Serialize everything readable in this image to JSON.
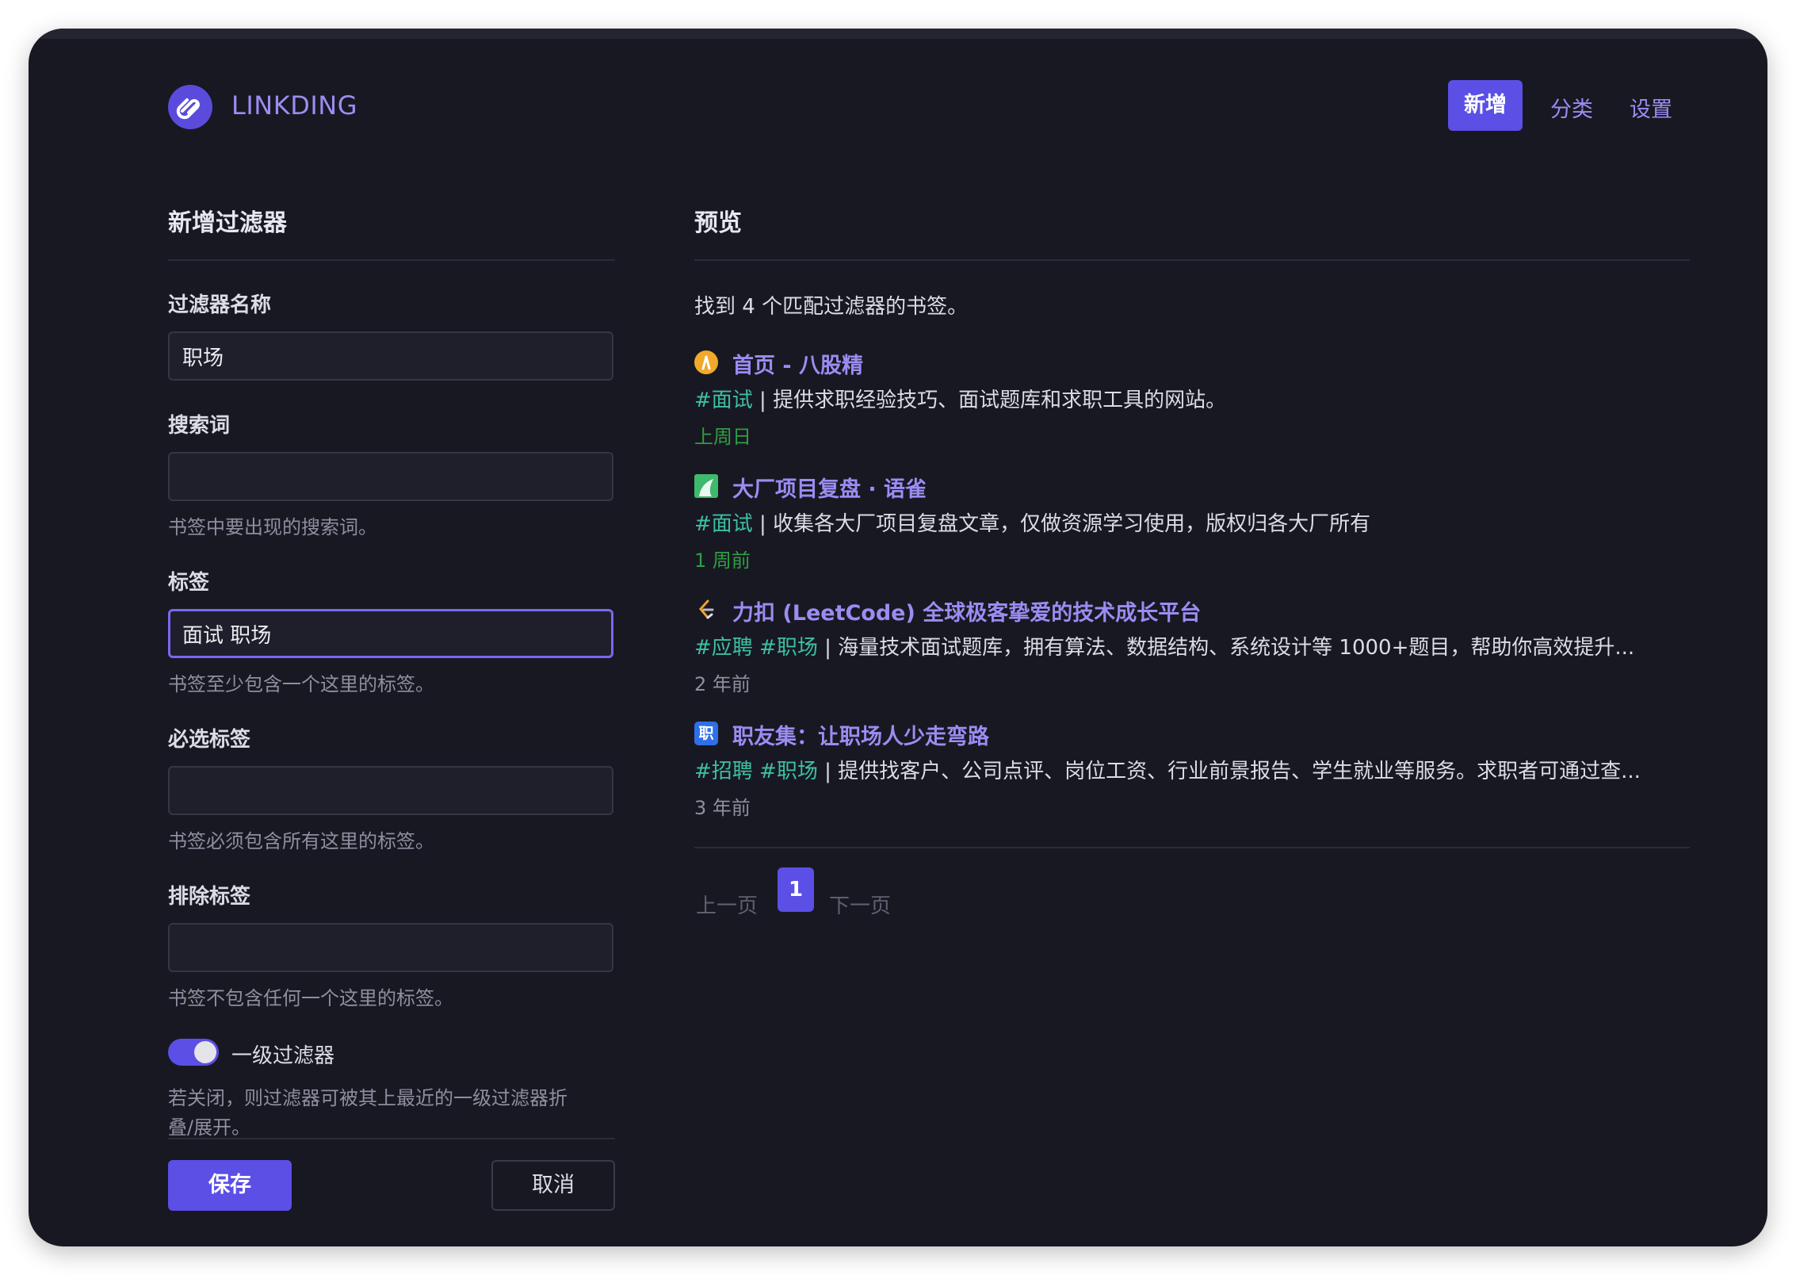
{
  "header": {
    "brand": "LINKDING",
    "nav_add": "新增",
    "nav_tags": "分类",
    "nav_settings": "设置"
  },
  "form": {
    "title": "新增过滤器",
    "name_label": "过滤器名称",
    "name_value": "职场",
    "search_label": "搜索词",
    "search_value": "",
    "search_hint": "书签中要出现的搜索词。",
    "tags_label": "标签",
    "tags_value": "面试 职场",
    "tags_hint": "书签至少包含一个这里的标签。",
    "required_tags_label": "必选标签",
    "required_tags_value": "",
    "required_tags_hint": "书签必须包含所有这里的标签。",
    "exclude_tags_label": "排除标签",
    "exclude_tags_value": "",
    "exclude_tags_hint": "书签不包含任何一个这里的标签。",
    "toggle_label": "一级过滤器",
    "toggle_on": true,
    "toggle_hint_line1": "若关闭，则过滤器可被其上最近的一级过滤器折",
    "toggle_hint_line2": "叠/展开。",
    "save_label": "保存",
    "cancel_label": "取消"
  },
  "preview": {
    "title": "预览",
    "summary": "找到 4 个匹配过滤器的书签。",
    "bookmarks": [
      {
        "icon": "bagu-favicon",
        "title": "首页 - 八股精",
        "tags": "#面试",
        "separator": " | ",
        "description": "提供求职经验技巧、面试题库和求职工具的网站。",
        "date": "上周日",
        "date_color": "#2f9f45"
      },
      {
        "icon": "yuque-favicon",
        "title": "大厂项目复盘 · 语雀",
        "tags": "#面试",
        "separator": " | ",
        "description": "收集各大厂项目复盘文章，仅做资源学习使用，版权归各大厂所有",
        "date": "1 周前",
        "date_color": "#2f9f45"
      },
      {
        "icon": "leetcode-favicon",
        "title": "力扣 (LeetCode) 全球极客挚爱的技术成长平台",
        "tags": "#应聘 #职场",
        "separator": " | ",
        "description": "海量技术面试题库，拥有算法、数据结构、系统设计等 1000+题目，帮助你高效提升...",
        "date": "2 年前",
        "date_color": "#8e8ea0"
      },
      {
        "icon": "zhiyouji-favicon",
        "title": "职友集：让职场人少走弯路",
        "tags": "#招聘 #职场",
        "separator": " | ",
        "description": "提供找客户、公司点评、岗位工资、行业前景报告、学生就业等服务。求职者可通过查...",
        "date": "3 年前",
        "date_color": "#8e8ea0"
      }
    ],
    "pagination": {
      "prev": "上一页",
      "current": "1",
      "next": "下一页"
    }
  },
  "colors": {
    "accent": "#5b4fe6",
    "link": "#9b8cf2",
    "tag": "#3cc0a2",
    "background": "#181822"
  }
}
